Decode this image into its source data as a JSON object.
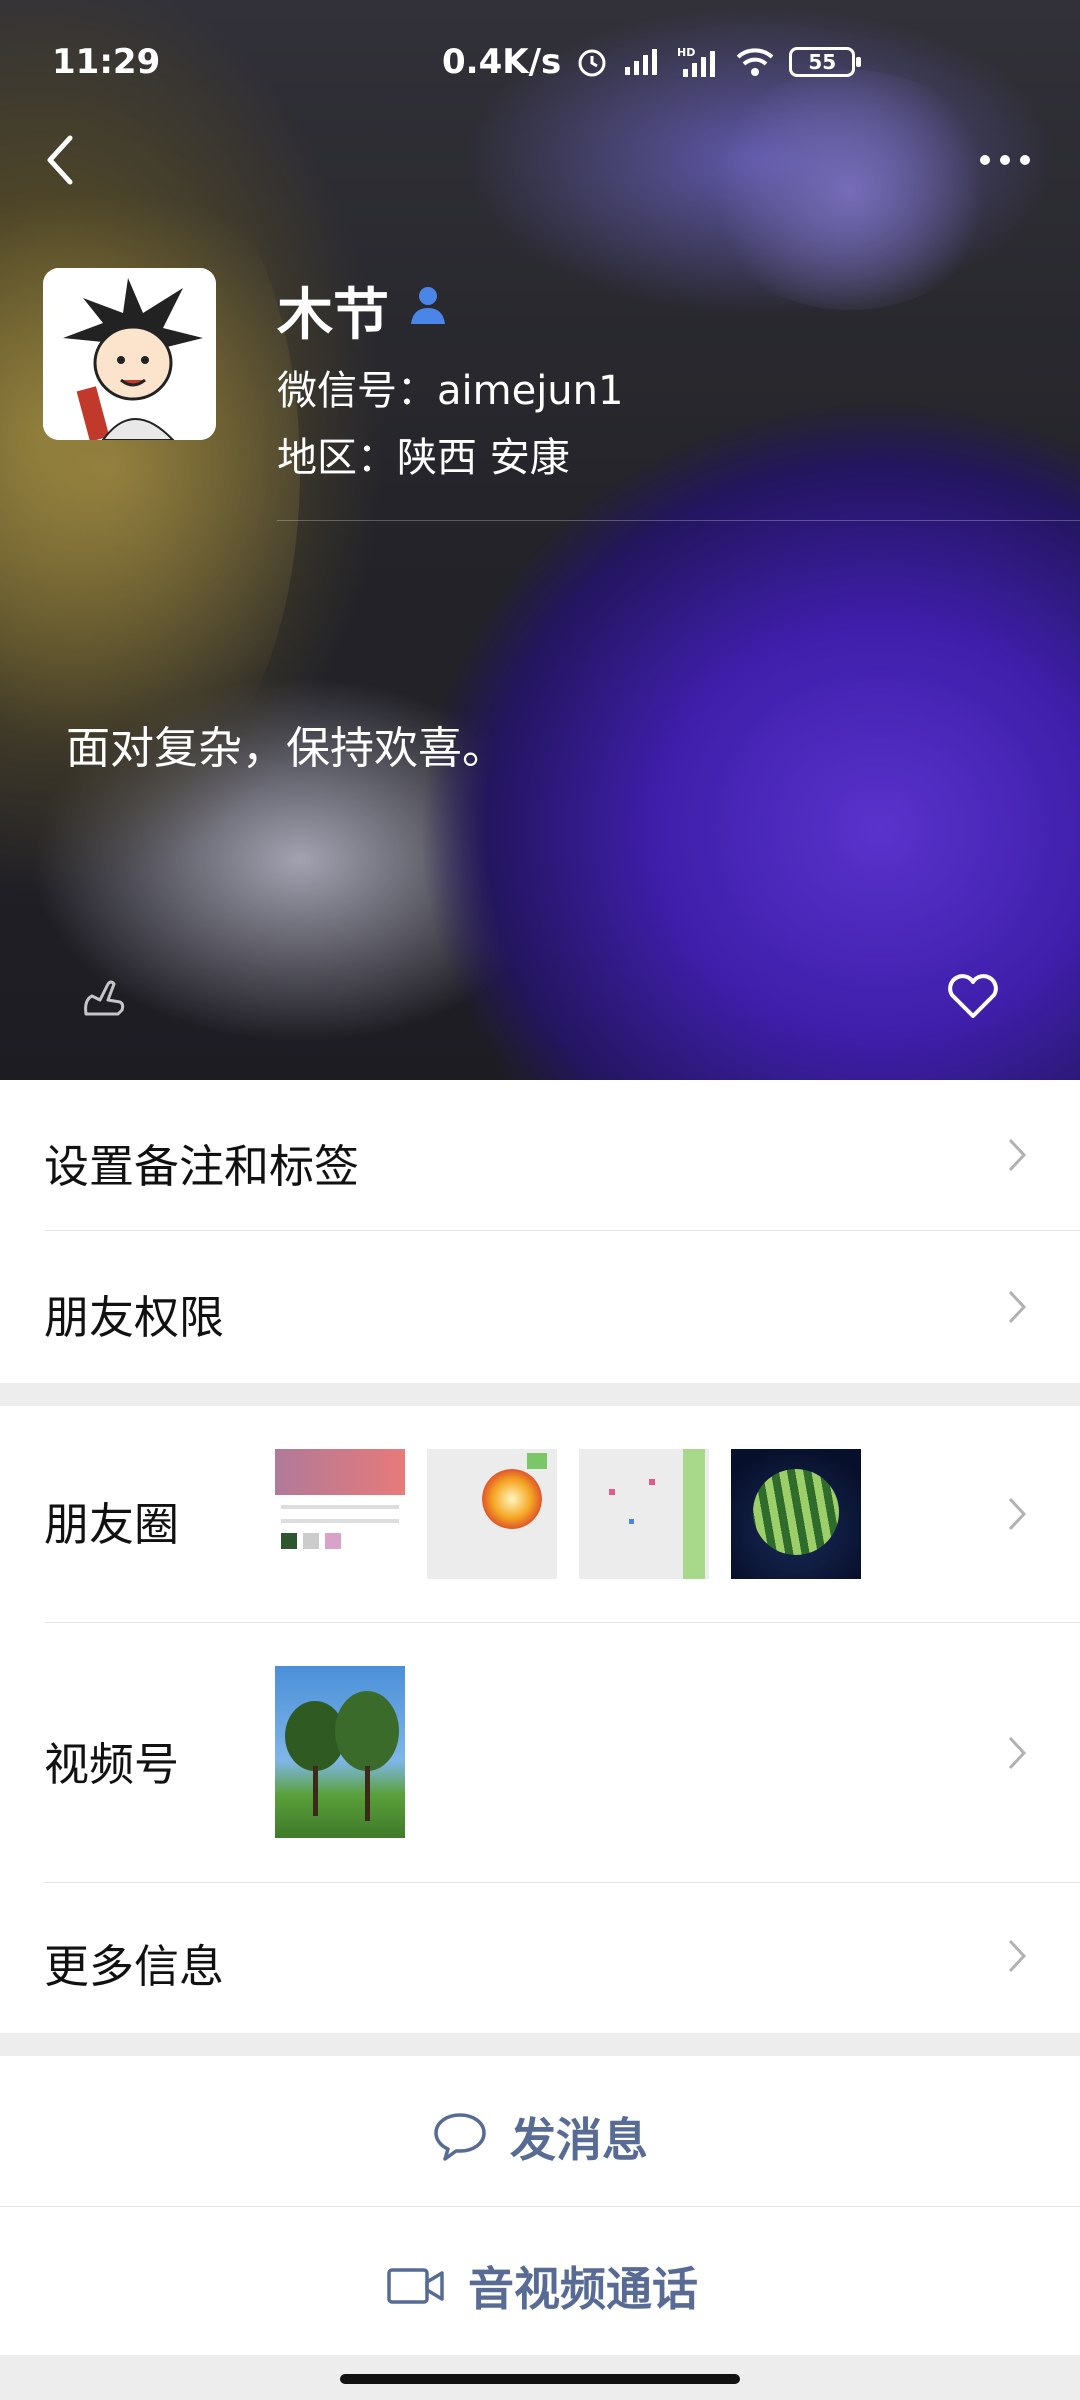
{
  "status_bar": {
    "time": "11:29",
    "speed": "0.4K/s",
    "battery": "55",
    "icons": [
      "alarm-icon",
      "signal-icon",
      "hd-signal-icon",
      "wifi-icon",
      "battery-icon"
    ]
  },
  "profile": {
    "name": "木节",
    "wechat_id": "微信号：aimejun1",
    "region": "地区：陕西  安康",
    "signature": "面对复杂，保持欢喜。"
  },
  "menu": {
    "remark": "设置备注和标签",
    "permissions": "朋友权限",
    "moments": "朋友圈",
    "channels": "视频号",
    "more_info": "更多信息"
  },
  "actions": {
    "message": "发消息",
    "call": "音视频通话"
  },
  "colors": {
    "link": "#576b95",
    "background": "#ededed",
    "accent_verify": "#4a86e8"
  }
}
